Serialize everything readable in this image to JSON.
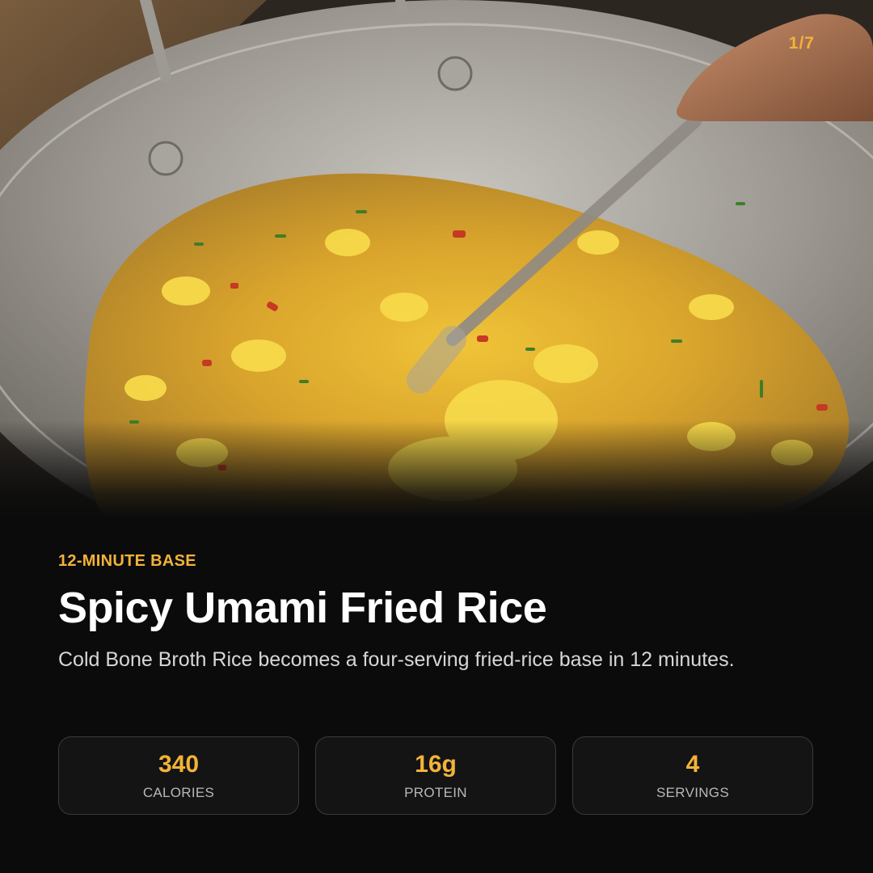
{
  "slide": {
    "counter": "1/7"
  },
  "recipe": {
    "eyebrow": "12-MINUTE BASE",
    "title": "Spicy Umami Fried Rice",
    "subtitle": "Cold Bone Broth Rice becomes a four-serving fried-rice base in 12 minutes."
  },
  "stats": [
    {
      "value": "340",
      "label": "CALORIES"
    },
    {
      "value": "16g",
      "label": "PROTEIN"
    },
    {
      "value": "4",
      "label": "SERVINGS"
    }
  ],
  "colors": {
    "accent": "#f2b338",
    "background": "#0b0b0b",
    "card_border": "#3a3a3a"
  }
}
